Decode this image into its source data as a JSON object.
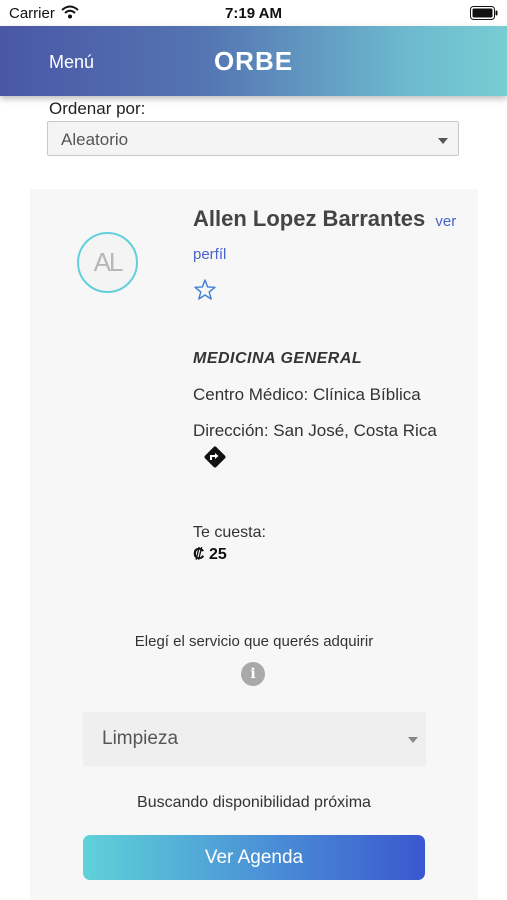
{
  "status_bar": {
    "carrier": "Carrier",
    "time": "7:19 AM"
  },
  "header": {
    "menu_label": "Menú",
    "title": "ORBE"
  },
  "sort": {
    "label": "Ordenar por:",
    "value": "Aleatorio"
  },
  "doctor": {
    "initials": "AL",
    "name": "Allen Lopez Barrantes",
    "view_profile": "ver perfíl",
    "specialty": "MEDICINA GENERAL",
    "medical_center": "Centro Médico: Clínica Bíblica",
    "address": "Dirección: San José, Costa Rica",
    "cost_label": "Te cuesta:",
    "cost_value": "₡ 25"
  },
  "service": {
    "prompt": "Elegí el servicio que querés adquirir",
    "info_glyph": "i",
    "selected": "Limpieza",
    "availability": "Buscando disponibilidad próxima",
    "agenda_button": "Ver Agenda"
  },
  "colors": {
    "header_start": "#4a57a6",
    "header_end": "#78cdd3",
    "accent_link": "#4a63c8",
    "avatar_ring": "#62d0db",
    "button_start": "#5fd2d8",
    "button_end": "#3a57cf"
  },
  "icons": {
    "wifi": "wifi-icon",
    "battery": "battery-icon",
    "favorite": "star-outline-icon",
    "directions": "directions-icon",
    "info": "info-icon",
    "dropdown": "chevron-down-icon"
  }
}
